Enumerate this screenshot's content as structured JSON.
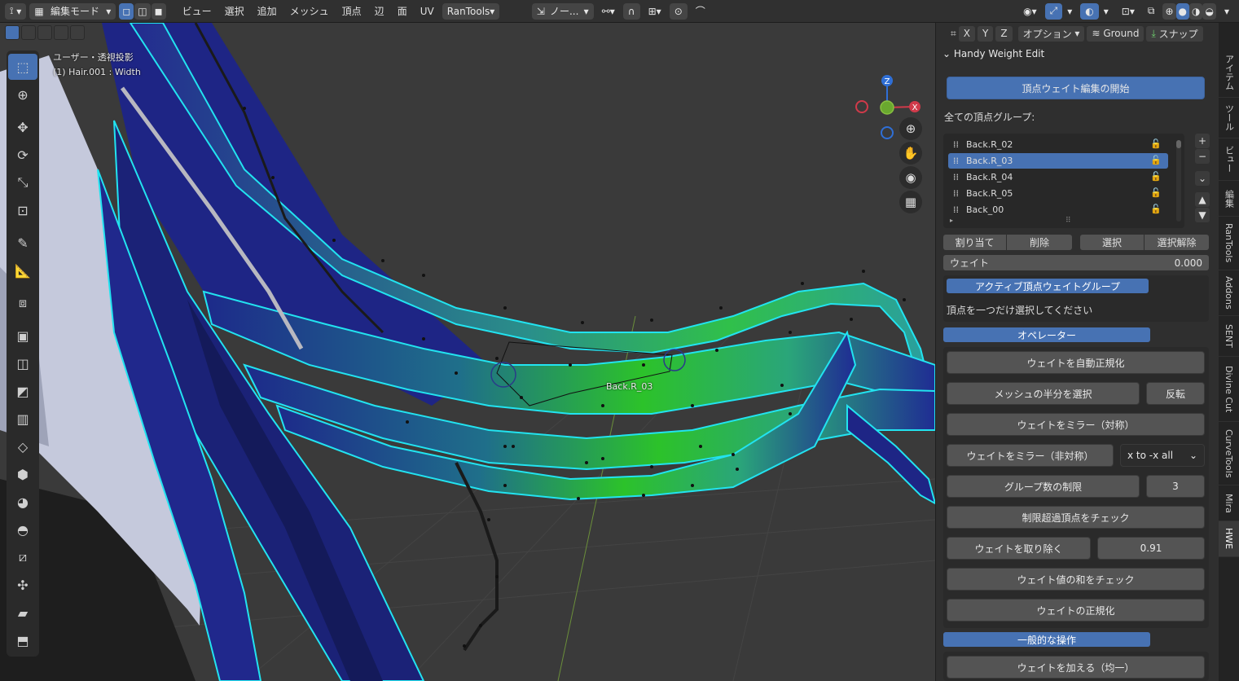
{
  "header": {
    "mode_label": "編集モード",
    "menus": [
      "ビュー",
      "選択",
      "追加",
      "メッシュ",
      "頂点",
      "辺",
      "面",
      "UV"
    ],
    "addon_menu": "RanTools",
    "transform_orient": "ノー...",
    "xyz": [
      "X",
      "Y",
      "Z"
    ],
    "options_label": "オプション",
    "snap_target": "Ground",
    "snap_label": "スナップ"
  },
  "viewport": {
    "view_name": "ユーザー・透視投影",
    "object_info": "(1) Hair.001 : Width",
    "bone_label": "Back.R_03",
    "gizmo": {
      "z": "Z",
      "x": "X"
    }
  },
  "panel": {
    "title": "Handy Weight Edit",
    "start_button": "頂点ウェイト編集の開始",
    "groups_label": "全ての頂点グループ:",
    "groups": [
      {
        "name": "Back.R_02",
        "selected": false
      },
      {
        "name": "Back.R_03",
        "selected": true
      },
      {
        "name": "Back.R_04",
        "selected": false
      },
      {
        "name": "Back.R_05",
        "selected": false
      },
      {
        "name": "Back_00",
        "selected": false
      }
    ],
    "assign": "割り当て",
    "remove": "削除",
    "select": "選択",
    "deselect": "選択解除",
    "weight_label": "ウェイト",
    "weight_value": "0.000",
    "active_group_header": "アクティブ頂点ウェイトグループ",
    "active_group_msg": "頂点を一つだけ選択してください",
    "operator_header": "オペレーター",
    "auto_normalize": "ウェイトを自動正規化",
    "select_half": "メッシュの半分を選択",
    "invert": "反転",
    "mirror_sym": "ウェイトをミラー（対称）",
    "mirror_asym": "ウェイトをミラー（非対称）",
    "mirror_dir": "x to -x all",
    "limit_groups": "グループ数の制限",
    "limit_value": "3",
    "check_over": "制限超過頂点をチェック",
    "remove_weight": "ウェイトを取り除く",
    "remove_value": "0.91",
    "check_sum": "ウェイト値の和をチェック",
    "normalize": "ウェイトの正規化",
    "general_header": "一般的な操作",
    "add_uniform": "ウェイトを加える（均一）"
  },
  "tabs": [
    "アイテム",
    "ツール",
    "ビュー",
    "編集",
    "RanTools",
    "Addons",
    "SENT",
    "Divine Cut",
    "CurveTools",
    "Mira",
    "HWE"
  ],
  "active_tab": "HWE"
}
